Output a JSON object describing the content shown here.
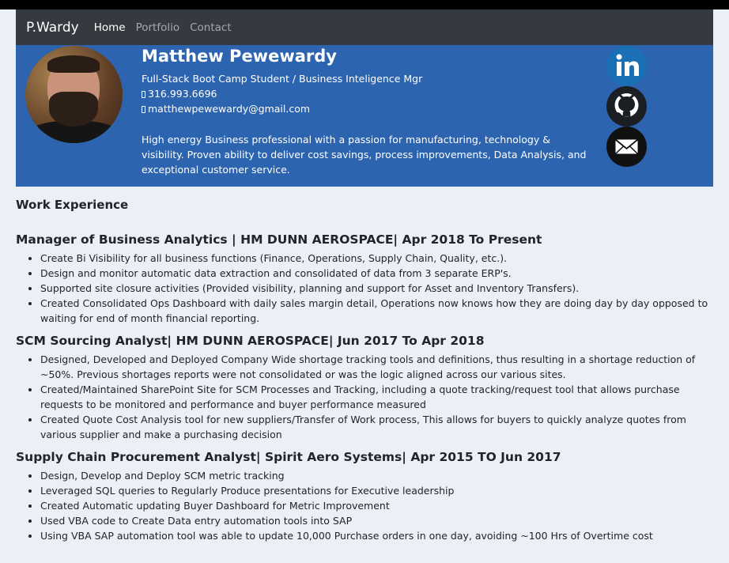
{
  "nav": {
    "brand": "P.Wardy",
    "links": [
      "Home",
      "Portfolio",
      "Contact"
    ],
    "active": "Home"
  },
  "profile": {
    "name": "Matthew Pewewardy",
    "tagline": "Full-Stack Boot Camp Student / Business Inteligence Mgr",
    "phone": "316.993.6696",
    "email": "matthewpewewardy@gmail.com",
    "bio": "High energy Business professional with a passion for manufacturing, technology & visibility. Proven ability to deliver cost savings, process improvements, Data Analysis, and exceptional customer service."
  },
  "social": [
    "linkedin-icon",
    "github-icon",
    "email-icon"
  ],
  "colors": {
    "hero": "#2c64b0",
    "navbar": "#343a40",
    "page": "#ebeff6",
    "linkedin": "#1b6fb4"
  },
  "experience": {
    "heading": "Work Experience",
    "jobs": [
      {
        "title": "Manager of Business Analytics | HM DUNN AEROSPACE| Apr 2018 To Present",
        "bullets": [
          "Create Bi Visibility for all business functions (Finance, Operations, Supply Chain, Quality, etc.).",
          "Design and monitor automatic data extraction and consolidated of data from 3 separate ERP's.",
          "Supported site closure activities (Provided visibility, planning and support for Asset and Inventory Transfers).",
          "Created Consolidated Ops Dashboard with daily sales margin detail, Operations now knows how they are doing day by day opposed to waiting for end of month financial reporting."
        ]
      },
      {
        "title": "SCM Sourcing Analyst| HM DUNN AEROSPACE| Jun 2017 To Apr 2018",
        "bullets": [
          "Designed, Developed and Deployed Company Wide shortage tracking tools and definitions, thus resulting in a shortage reduction of ~50%. Previous shortages reports were not consolidated or was the logic aligned across our various sites.",
          "Created/Maintained SharePoint Site for SCM Processes and Tracking, including a quote tracking/request tool that allows purchase requests to be monitored and performance and buyer performance measured",
          "Created Quote Cost Analysis tool for new suppliers/Transfer of Work process, This allows for buyers to quickly analyze quotes from various supplier and make a purchasing decision"
        ]
      },
      {
        "title": "Supply Chain Procurement Analyst| Spirit Aero Systems| Apr 2015 TO Jun 2017",
        "bullets": [
          "Design, Develop and Deploy SCM metric tracking",
          "Leveraged SQL queries to Regularly Produce presentations for Executive leadership",
          "Created Automatic updating Buyer Dashboard for Metric Improvement",
          "Used VBA code to Create Data entry automation tools into SAP",
          "Using VBA SAP automation tool was able to update 10,000 Purchase orders in one day, avoiding ~100 Hrs of Overtime cost"
        ]
      }
    ]
  }
}
